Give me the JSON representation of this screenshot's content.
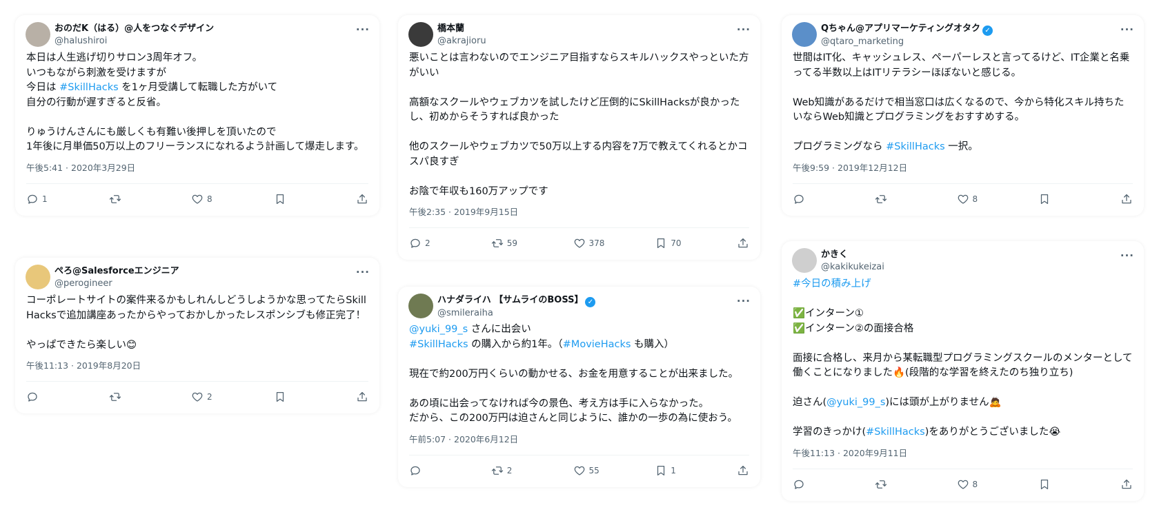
{
  "columns": [
    {
      "cards": [
        {
          "name": "おのだK（はる）@人をつなぐデザイン",
          "handle": "@halushiroi",
          "verified": false,
          "avatar_color": "#b8b0a6",
          "segments": [
            {
              "t": "本日は人生逃げ切りサロン3周年オフ。\nいつもながら刺激を受けますが\n今日は "
            },
            {
              "t": "#SkillHacks",
              "link": true
            },
            {
              "t": " を1ヶ月受講して転職した方がいて\n自分の行動が遅すぎると反省。\n\nりゅうけんさんにも厳しくも有難い後押しを頂いたので\n1年後に月単価50万以上のフリーランスになれるよう計画して爆走します。"
            }
          ],
          "time": "午後5:41 · 2020年3月29日",
          "counts": {
            "reply": "1",
            "retweet": "",
            "like": "8",
            "bookmark": ""
          }
        },
        {
          "name": "ぺろ@Salesforceエンジニア",
          "handle": "@perogineer",
          "verified": false,
          "avatar_color": "#e8c77a",
          "segments": [
            {
              "t": "コーポレートサイトの案件来るかもしれんしどうしようかな思ってたらSkillHacksで追加講座あったからやっておかしかったレスポンシブも修正完了！\n\nやっぱできたら楽しい😊"
            }
          ],
          "time": "午後11:13 · 2019年8月20日",
          "counts": {
            "reply": "",
            "retweet": "",
            "like": "2",
            "bookmark": ""
          }
        }
      ]
    },
    {
      "cards": [
        {
          "name": "橋本蘭",
          "handle": "@akrajioru",
          "verified": false,
          "avatar_color": "#3a3a3a",
          "segments": [
            {
              "t": "悪いことは言わないのでエンジニア目指すならスキルハックスやっといた方がいい\n\n高額なスクールやウェブカツを試したけど圧倒的にSkillHacksが良かったし、初めからそうすれば良かった\n\n他のスクールやウェブカツで50万以上する内容を7万で教えてくれるとかコスパ良すぎ\n\nお陰で年収も160万アップです"
            }
          ],
          "time": "午後2:35 · 2019年9月15日",
          "counts": {
            "reply": "2",
            "retweet": "59",
            "like": "378",
            "bookmark": "70"
          }
        },
        {
          "name": "ハナダライハ 【サムライのBOSS】",
          "handle": "@smileraiha",
          "verified": true,
          "avatar_color": "#6f7a52",
          "segments": [
            {
              "t": "@yuki_99_s",
              "link": true
            },
            {
              "t": " さんに出会い\n"
            },
            {
              "t": "#SkillHacks",
              "link": true
            },
            {
              "t": " の購入から約1年。（"
            },
            {
              "t": "#MovieHacks",
              "link": true
            },
            {
              "t": " も購入）\n\n現在で約200万円くらいの動かせる、お金を用意することが出来ました。\n\nあの頃に出会ってなければ今の景色、考え方は手に入らなかった。\nだから、この200万円は迫さんと同じように、誰かの一歩の為に使おう。"
            }
          ],
          "time": "午前5:07 · 2020年6月12日",
          "counts": {
            "reply": "",
            "retweet": "2",
            "like": "55",
            "bookmark": "1"
          }
        }
      ]
    },
    {
      "cards": [
        {
          "name": "Qちゃん@アプリマーケティングオタク",
          "handle": "@qtaro_marketing",
          "verified": true,
          "avatar_color": "#5b8fc9",
          "segments": [
            {
              "t": "世間はIT化、キャッシュレス、ペーパーレスと言ってるけど、IT企業と名乗ってる半数以上はITリテラシーほぼないと感じる。\n\nWeb知識があるだけで相当窓口は広くなるので、今から特化スキル持ちたいならWeb知識とプログラミングをおすすめする。\n\nプログラミングなら "
            },
            {
              "t": "#SkillHacks",
              "link": true
            },
            {
              "t": " 一択。"
            }
          ],
          "time": "午後9:59 · 2019年12月12日",
          "counts": {
            "reply": "",
            "retweet": "",
            "like": "8",
            "bookmark": ""
          }
        },
        {
          "name": "かきく",
          "handle": "@kakikukeizai",
          "verified": false,
          "avatar_color": "#cfcfcf",
          "segments": [
            {
              "t": "#今日の積み上げ",
              "link": true
            },
            {
              "t": "\n\n✅インターン①\n✅インターン②の面接合格\n\n面接に合格し、来月から某転職型プログラミングスクールのメンターとして働くことになりました🔥(段階的な学習を終えたのち独り立ち)\n\n迫さん("
            },
            {
              "t": "@yuki_99_s",
              "link": true
            },
            {
              "t": ")には頭が上がりません🙇\n\n学習のきっかけ("
            },
            {
              "t": "#SkillHacks",
              "link": true
            },
            {
              "t": ")をありがとうございました😭"
            }
          ],
          "time": "午後11:13 · 2020年9月11日",
          "counts": {
            "reply": "",
            "retweet": "",
            "like": "8",
            "bookmark": ""
          }
        }
      ]
    }
  ],
  "icons": {
    "more": "more-icon",
    "reply": "reply-icon",
    "retweet": "retweet-icon",
    "like": "heart-icon",
    "bookmark": "bookmark-icon",
    "share": "share-icon",
    "verified": "verified-badge-icon"
  },
  "colors": {
    "link": "#1d9bf0",
    "verified": "#1d9bf0",
    "muted": "#536471"
  }
}
